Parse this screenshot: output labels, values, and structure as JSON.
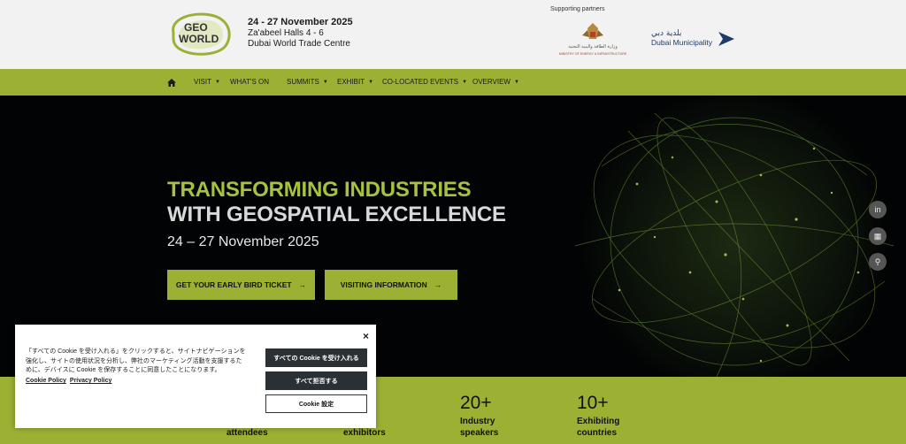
{
  "header": {
    "logo_line1": "GEO",
    "logo_line2": "WORLD",
    "event_date": "24 - 27 November 2025",
    "venue_line1": "Za'abeel Halls 4 - 6",
    "venue_line2": "Dubai World Trade Centre",
    "partners_label": "Supporting partners",
    "partner1_text_ar": "وزارة الطاقة والبنية التحتية",
    "partner1_text_en": "MINISTRY OF ENERGY & INFRASTRUCTURE",
    "partner2_text_ar": "بلدية دبي",
    "partner2_text_en": "Dubai Municipality"
  },
  "nav": {
    "home_icon": "home-icon",
    "items": [
      {
        "label": "VISIT",
        "caret": "▼"
      },
      {
        "label": "WHAT'S ON",
        "caret": ""
      },
      {
        "label": "SUMMITS",
        "caret": "▼"
      },
      {
        "label": "EXHIBIT",
        "caret": "▼"
      },
      {
        "label": "CO-LOCATED EVENTS",
        "caret": "▼"
      },
      {
        "label": "OVERVIEW",
        "caret": "▼"
      }
    ]
  },
  "hero": {
    "title_line1": "TRANSFORMING INDUSTRIES",
    "title_line2": "WITH GEOSPATIAL EXCELLENCE",
    "date": "24 – 27 November 2025",
    "btn_ticket": "GET YOUR EARLY BIRD TICKET",
    "btn_visit": "VISITING INFORMATION",
    "arrow": "→"
  },
  "side_icons": [
    {
      "name": "linkedin-icon",
      "glyph": "in"
    },
    {
      "name": "calendar-icon",
      "glyph": "▦"
    },
    {
      "name": "search-icon",
      "glyph": "⚲"
    }
  ],
  "stats": [
    {
      "num": "",
      "label1": "attendees",
      "label2": ""
    },
    {
      "num": "",
      "label1": "exhibitors",
      "label2": ""
    },
    {
      "num": "20+",
      "label1": "Industry",
      "label2": "speakers"
    },
    {
      "num": "10+",
      "label1": "Exhibiting",
      "label2": "countries"
    }
  ],
  "cookie": {
    "close": "×",
    "text": "「すべての Cookie を受け入れる」をクリックすると、サイトナビゲーションを強化し、サイトの使用状況を分析し、弊社のマーケティング活動を支援するために、デバイスに Cookie を保存することに同意したことになります。",
    "link_cookie": "Cookie Policy",
    "link_privacy": "Privacy Policy",
    "btn_accept": "すべての Cookie を受け入れる",
    "btn_reject": "すべて拒否する",
    "btn_settings": "Cookie 設定"
  },
  "colors": {
    "accent": "#9cb034",
    "headline_green": "#a6c23e",
    "hero_bg": "#020304"
  }
}
